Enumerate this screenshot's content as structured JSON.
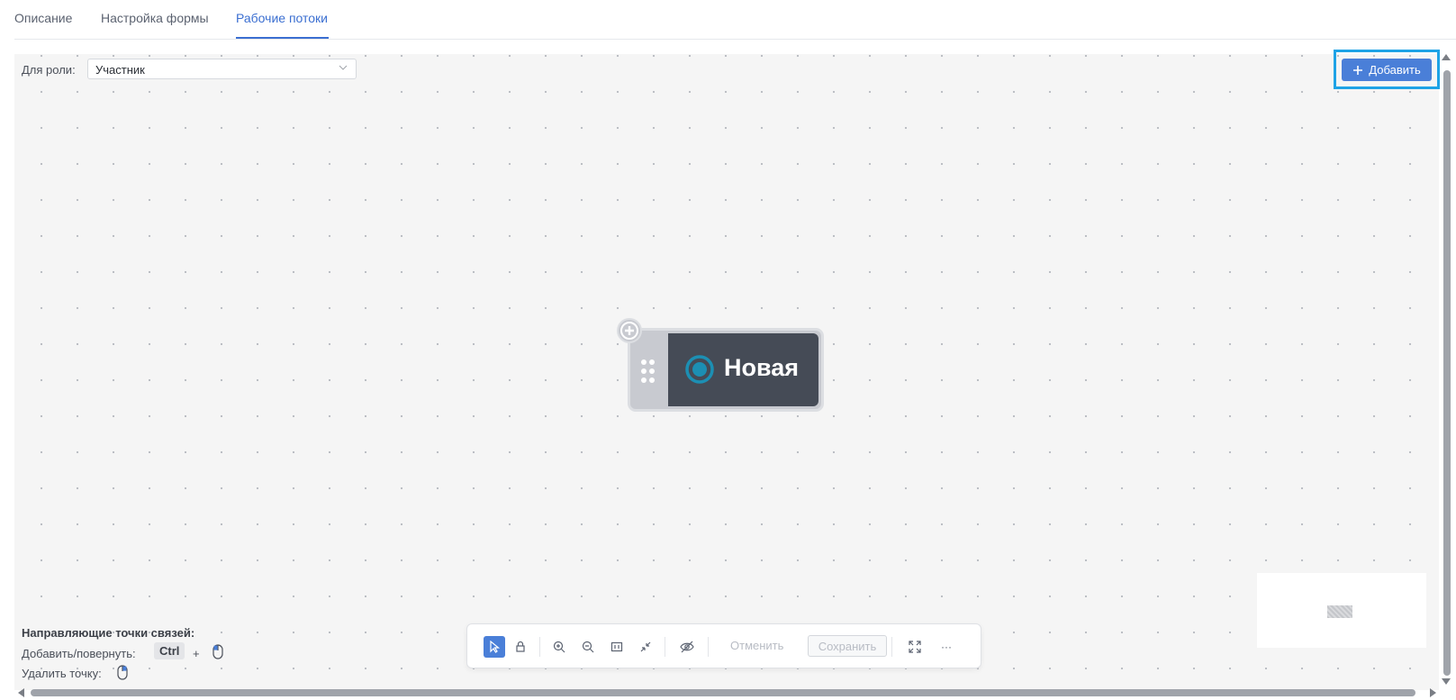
{
  "tabs": [
    {
      "label": "Описание",
      "active": false
    },
    {
      "label": "Настройка формы",
      "active": false
    },
    {
      "label": "Рабочие потоки",
      "active": true
    }
  ],
  "role_filter": {
    "label": "Для роли:",
    "value": "Участник"
  },
  "add_button": {
    "label": "Добавить",
    "icon": "plus-icon"
  },
  "node": {
    "label": "Новая",
    "status_icon": "radio-dot-icon",
    "grip_icon": "grip-dots-icon",
    "add_icon": "plus-circle-icon"
  },
  "hints": {
    "title": "Направляющие точки связей:",
    "add_rotate": "Добавить/повернуть:",
    "key": "Ctrl",
    "plus": "+",
    "delete": "Удалить точку:"
  },
  "toolbar": {
    "undo_label": "Отменить",
    "save_label": "Сохранить",
    "more_label": "···",
    "icons": [
      "pointer-icon",
      "lock-icon",
      "zoom-in-icon",
      "zoom-out-icon",
      "actual-size-icon",
      "fit-icon",
      "eye-off-icon",
      "fullscreen-icon",
      "more-icon"
    ]
  },
  "colors": {
    "accent": "#4a7fd8",
    "highlight": "#1ea3e6",
    "node_dark": "#454b56",
    "status_teal": "#1c8fb3"
  }
}
